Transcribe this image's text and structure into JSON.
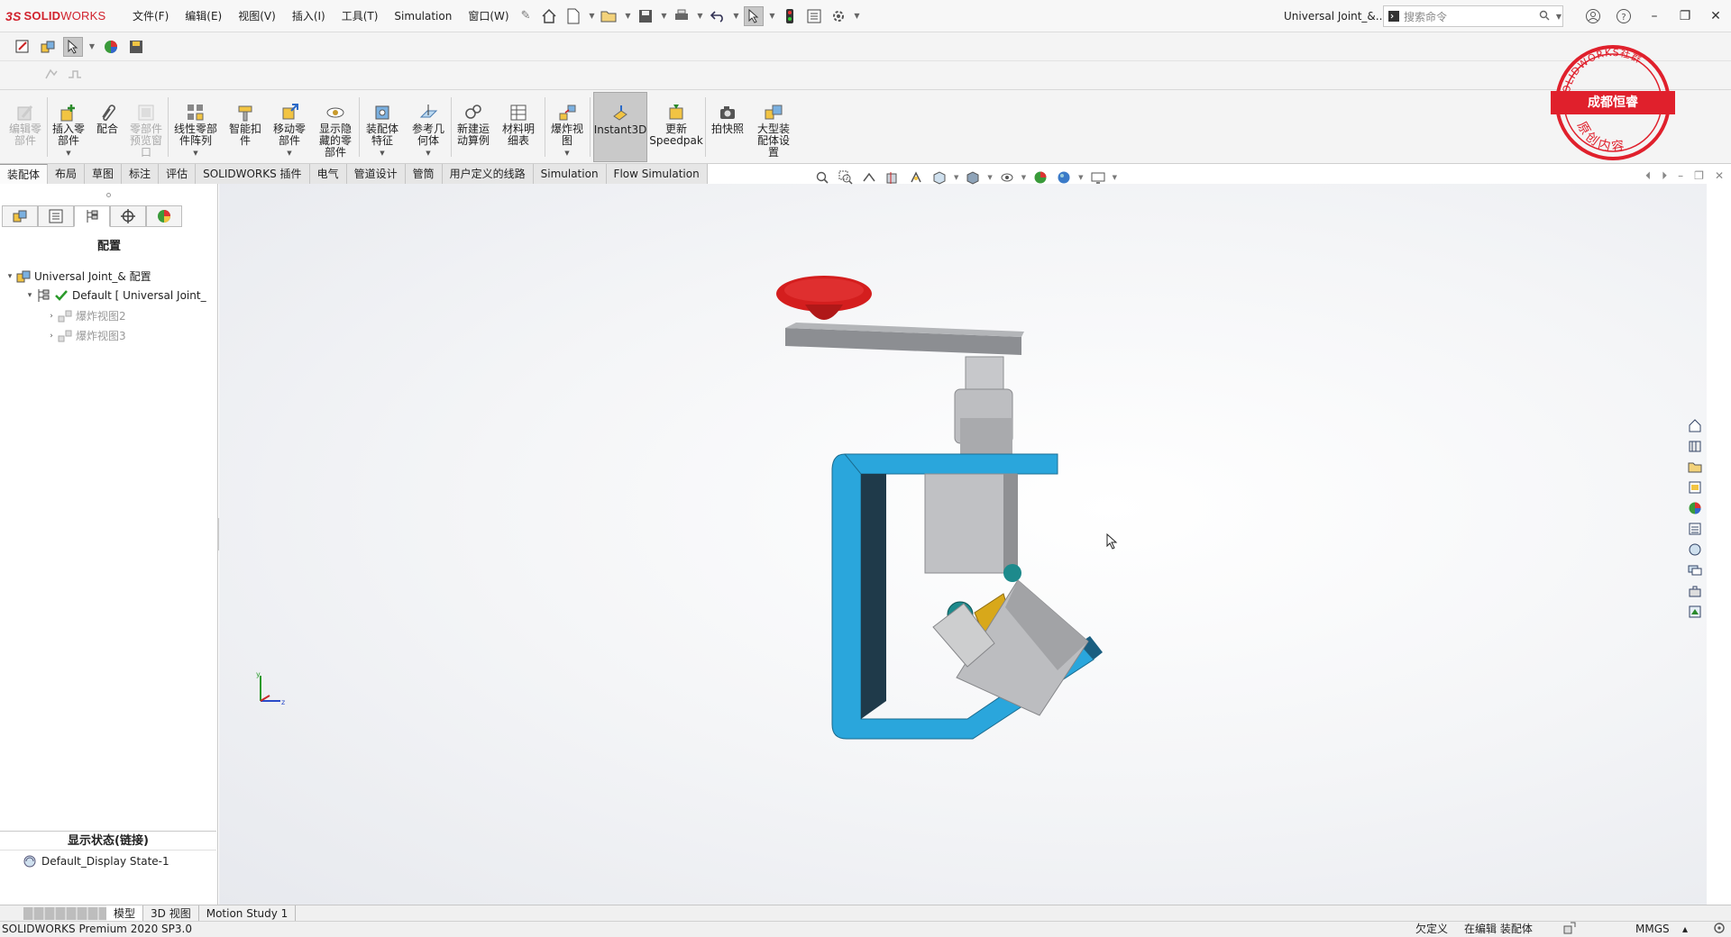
{
  "app": {
    "logo_ds": "3S",
    "logo_solid": "SOLID",
    "logo_works": "WORKS",
    "menus": [
      "文件(F)",
      "编辑(E)",
      "视图(V)",
      "插入(I)",
      "工具(T)",
      "Simulation",
      "窗口(W)"
    ],
    "document_title": "Universal Joint_&....",
    "search_placeholder": "搜索命令"
  },
  "command_manager": {
    "buttons": [
      {
        "label": "编辑零\n部件",
        "disabled": true
      },
      {
        "label": "插入零\n部件",
        "disabled": false
      },
      {
        "label": "配合",
        "disabled": false
      },
      {
        "label": "零部件\n预览窗\n口",
        "disabled": true
      },
      {
        "label": "线性零部\n件阵列",
        "disabled": false
      },
      {
        "label": "智能扣\n件",
        "disabled": false
      },
      {
        "label": "移动零\n部件",
        "disabled": false
      },
      {
        "label": "显示隐\n藏的零\n部件",
        "disabled": false
      },
      {
        "label": "装配体\n特征",
        "disabled": false
      },
      {
        "label": "参考几\n何体",
        "disabled": false
      },
      {
        "label": "新建运\n动算例",
        "disabled": false
      },
      {
        "label": "材料明\n细表",
        "disabled": false
      },
      {
        "label": "爆炸视\n图",
        "disabled": false
      },
      {
        "label": "Instant3D",
        "disabled": false
      },
      {
        "label": "更新\nSpeedpak",
        "disabled": false
      },
      {
        "label": "拍快照",
        "disabled": false
      },
      {
        "label": "大型装\n配体设\n置",
        "disabled": false
      }
    ]
  },
  "tabs": [
    "装配体",
    "布局",
    "草图",
    "标注",
    "评估",
    "SOLIDWORKS 插件",
    "电气",
    "管道设计",
    "管筒",
    "用户定义的线路",
    "Simulation",
    "Flow Simulation"
  ],
  "active_tab": "装配体",
  "panel": {
    "title": "配置",
    "tree": {
      "root": "Universal Joint_& 配置",
      "config": "Default [ Universal Joint_",
      "items": [
        "爆炸视图2",
        "爆炸视图3"
      ]
    },
    "display_state_header": "显示状态(链接)",
    "display_state": "Default_Display State-1"
  },
  "stamp": {
    "top_text": "SOLIDWORKS社群",
    "band_text": "成都恒睿",
    "bottom_text": "原创内容"
  },
  "triad": {
    "x": "z",
    "y": "y"
  },
  "bottom_tabs": [
    "模型",
    "3D 视图",
    "Motion Study 1"
  ],
  "active_bottom_tab": "模型",
  "status": {
    "product": "SOLIDWORKS Premium 2020 SP3.0",
    "state": "欠定义",
    "mode": "在编辑 装配体",
    "units": "MMGS"
  },
  "colors": {
    "bracket": "#2aa6dc",
    "knob": "#d41e1e",
    "steel": "#bfc0c3",
    "pin": "#1d8a8c",
    "accent": "#e0202c"
  }
}
